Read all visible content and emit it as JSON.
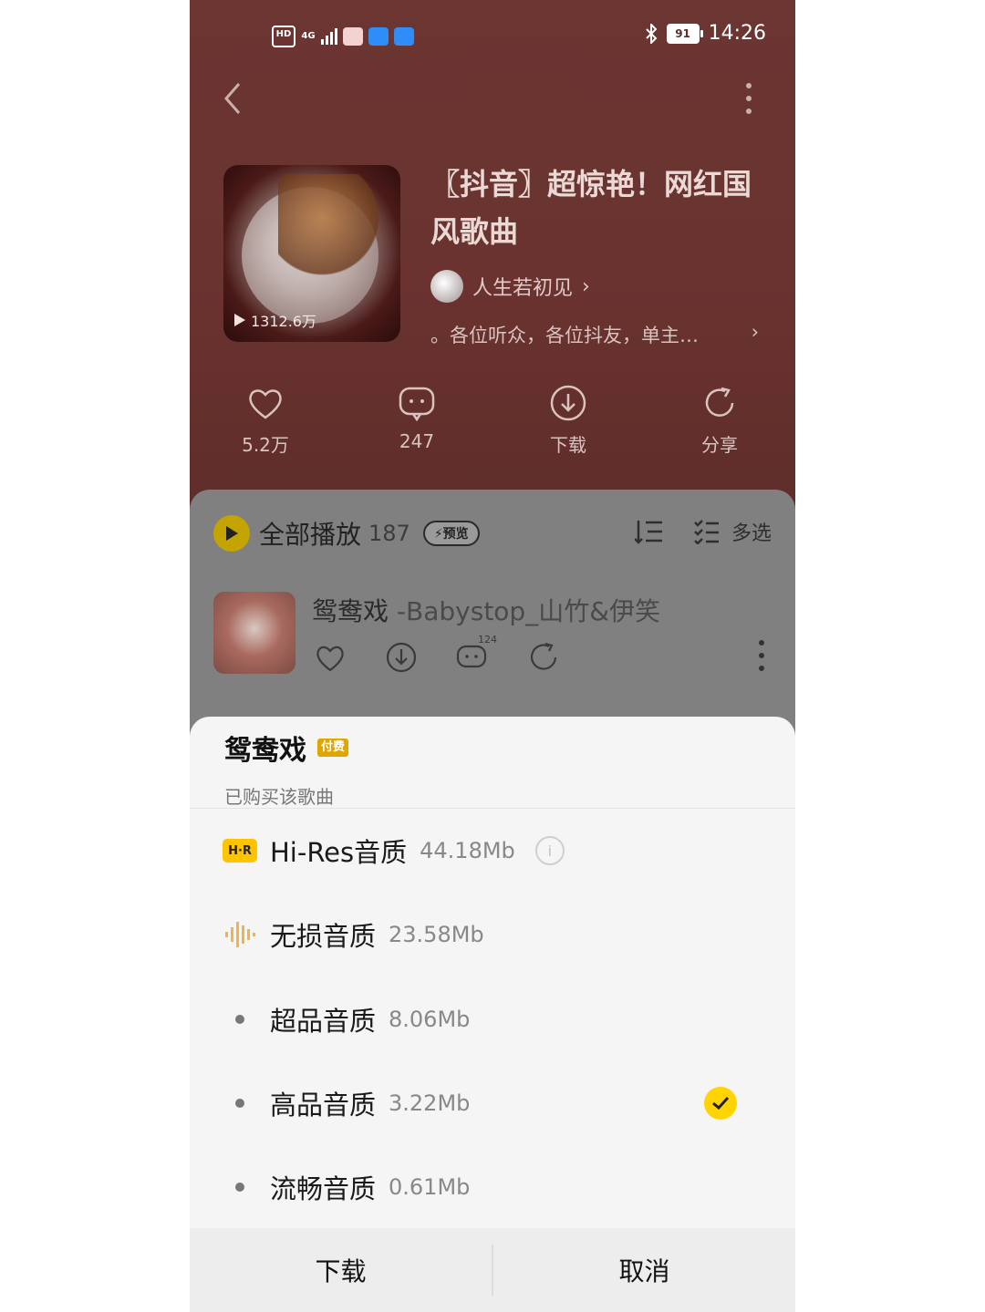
{
  "status_bar": {
    "net": "4G",
    "hd": "HD",
    "battery": "91",
    "time": "14:26"
  },
  "playlist": {
    "title": "〖抖音〗超惊艳！网红国风歌曲",
    "play_count": "1312.6万",
    "author": "人生若初见",
    "description": "。各位听众，各位抖友，单主…",
    "actions": {
      "like": "5.2万",
      "comment": "247",
      "download": "下载",
      "share": "分享"
    }
  },
  "list": {
    "play_all_label": "全部播放",
    "count": "187",
    "preview_badge": "预览",
    "multi_select": "多选",
    "song": {
      "title": "鸳鸯戏",
      "artist": " -Babystop_山竹&伊笑",
      "comment_count": "124"
    }
  },
  "sheet": {
    "song_title": "鸳鸯戏",
    "paid_badge": "付费",
    "subtitle": "已购买该歌曲",
    "options": [
      {
        "badge": "H·R",
        "label": "Hi-Res音质",
        "size": "44.18Mb",
        "info": "i"
      },
      {
        "label": "无损音质",
        "size": "23.58Mb"
      },
      {
        "label": "超品音质",
        "size": "8.06Mb"
      },
      {
        "label": "高品音质",
        "size": "3.22Mb",
        "selected": true
      },
      {
        "label": "流畅音质",
        "size": "0.61Mb"
      }
    ],
    "download": "下载",
    "cancel": "取消"
  },
  "colors": {
    "accent": "#ffd400",
    "hero_bg": "#6b3532",
    "overlay_gray": "#808080"
  }
}
